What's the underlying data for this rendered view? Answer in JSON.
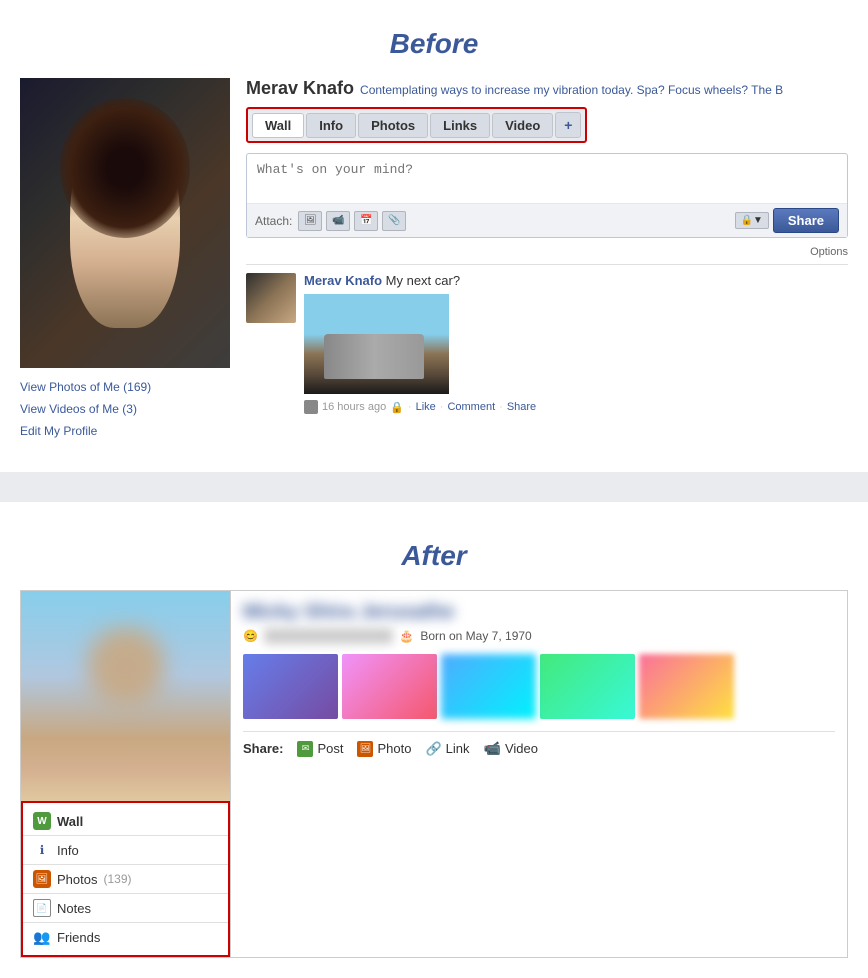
{
  "before": {
    "section_title": "Before",
    "profile": {
      "name": "Merav Knafo",
      "status": "Contemplating ways to increase my vibration today. Spa? Focus wheels? The B",
      "sidebar_links": [
        {
          "id": "view-photos",
          "text": "View Photos of Me (169)"
        },
        {
          "id": "view-videos",
          "text": "View Videos of Me (3)"
        },
        {
          "id": "edit-profile",
          "text": "Edit My Profile"
        }
      ],
      "tabs": [
        {
          "id": "wall",
          "label": "Wall",
          "active": true
        },
        {
          "id": "info",
          "label": "Info",
          "active": false
        },
        {
          "id": "photos",
          "label": "Photos",
          "active": false
        },
        {
          "id": "links",
          "label": "Links",
          "active": false
        },
        {
          "id": "video",
          "label": "Video",
          "active": false
        },
        {
          "id": "plus",
          "label": "+",
          "active": false
        }
      ],
      "wall_placeholder": "What's on your mind?",
      "attach_label": "Attach:",
      "share_btn": "Share",
      "options_label": "Options",
      "post": {
        "author": "Merav Knafo",
        "text": "My next car?",
        "time": "16 hours ago",
        "like": "Like",
        "comment": "Comment",
        "share": "Share"
      }
    }
  },
  "after": {
    "section_title": "After",
    "profile": {
      "name_blurred": "Micky Shira Jerusathe",
      "meta_relationship": "in a Relationship with",
      "meta_born": "Born on May 7, 1970",
      "nav_items": [
        {
          "id": "wall",
          "label": "Wall",
          "icon": "wall",
          "count": "",
          "active": true
        },
        {
          "id": "info",
          "label": "Info",
          "icon": "info",
          "count": "",
          "active": false
        },
        {
          "id": "photos",
          "label": "Photos",
          "icon": "photos",
          "count": "(139)",
          "active": false
        },
        {
          "id": "notes",
          "label": "Notes",
          "icon": "notes",
          "count": "",
          "active": false
        },
        {
          "id": "friends",
          "label": "Friends",
          "icon": "friends",
          "count": "",
          "active": false
        }
      ],
      "share_label": "Share:",
      "share_items": [
        {
          "id": "post",
          "label": "Post",
          "icon": "post"
        },
        {
          "id": "photo",
          "label": "Photo",
          "icon": "photo"
        },
        {
          "id": "link",
          "label": "Link",
          "icon": "link"
        },
        {
          "id": "video",
          "label": "Video",
          "icon": "video"
        }
      ]
    }
  },
  "icons": {
    "wall": "🌿",
    "photos": "🖼",
    "notes": "📄",
    "friends": "👥",
    "post": "✉",
    "photo": "📷",
    "link": "🔗",
    "video": "🎥"
  }
}
